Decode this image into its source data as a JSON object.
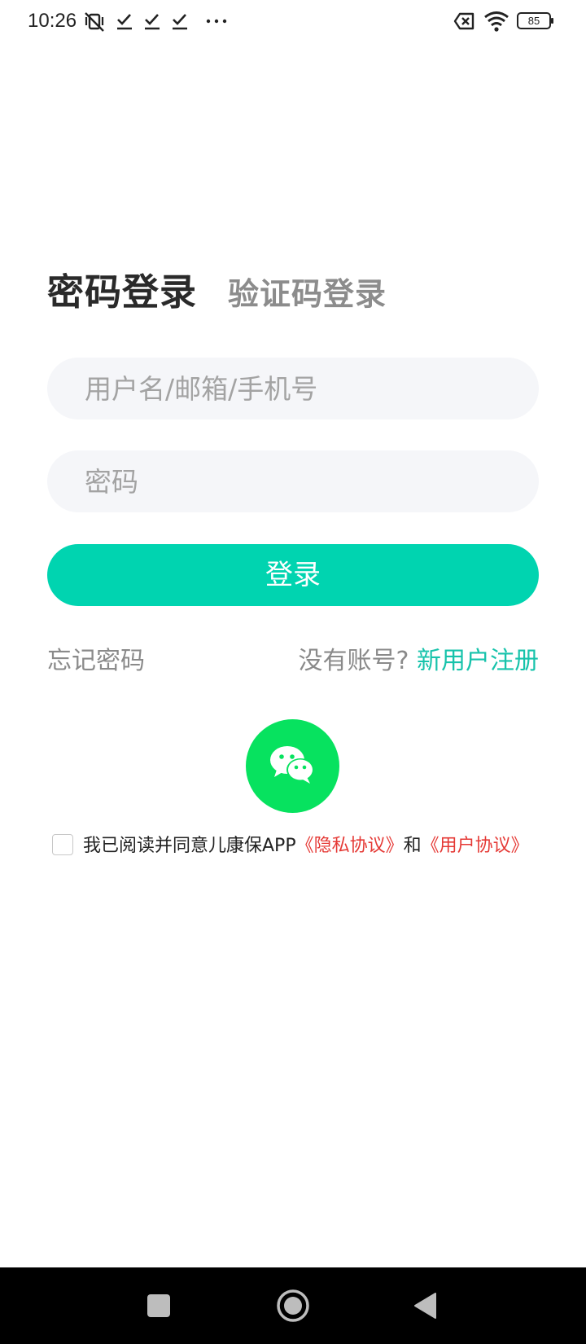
{
  "status_bar": {
    "time": "10:26",
    "battery": "85",
    "icons": [
      "muted-vibrate-icon",
      "check-icon",
      "check-icon",
      "check-icon",
      "more-dots-icon",
      "no-sim-icon",
      "wifi-icon",
      "battery-icon"
    ]
  },
  "login_tabs": {
    "password_login": "密码登录",
    "sms_login": "验证码登录"
  },
  "form": {
    "username_placeholder": "用户名/邮箱/手机号",
    "password_placeholder": "密码",
    "login_button": "登录"
  },
  "links": {
    "forgot_password": "忘记密码",
    "no_account": "没有账号?",
    "register": "新用户注册"
  },
  "social": {
    "icon": "wechat-icon"
  },
  "agreement": {
    "prefix": "我已阅读并同意儿康保APP",
    "privacy": "《隐私协议》",
    "and": "和",
    "user_agreement": "《用户协议》"
  },
  "nav_bar": {
    "icons": [
      "recent-apps-icon",
      "home-icon",
      "back-icon"
    ]
  },
  "colors": {
    "accent": "#00d4b0",
    "link": "#17c3ab",
    "wechat": "#07e25f",
    "agreement_link": "#e53935"
  }
}
